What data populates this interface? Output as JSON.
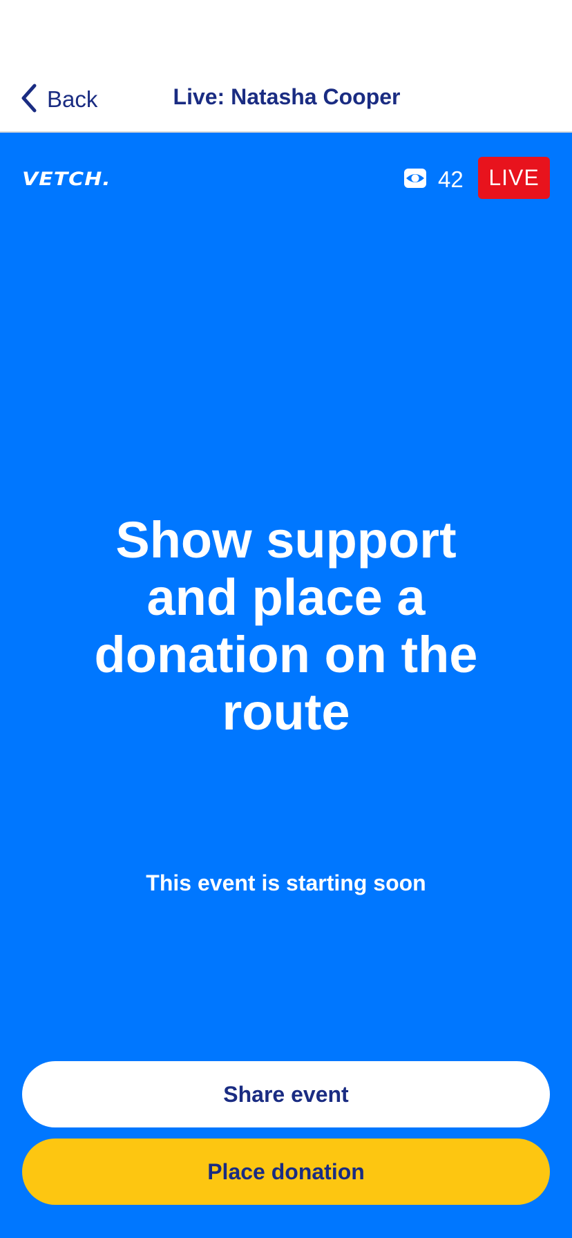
{
  "nav": {
    "back_label": "Back",
    "title": "Live: Natasha Cooper"
  },
  "stream": {
    "brand": "VETCH.",
    "viewer_icon": "eye-icon",
    "viewer_count": "42",
    "live_badge": "LIVE",
    "headline": "Show support and place a donation on the route",
    "status_text": "This event is starting soon"
  },
  "actions": {
    "share_label": "Share event",
    "donate_label": "Place donation"
  },
  "colors": {
    "primary_blue": "#0077ff",
    "navy_text": "#1a2c82",
    "live_red": "#e8131d",
    "donate_yellow": "#fdc611",
    "white": "#ffffff"
  }
}
